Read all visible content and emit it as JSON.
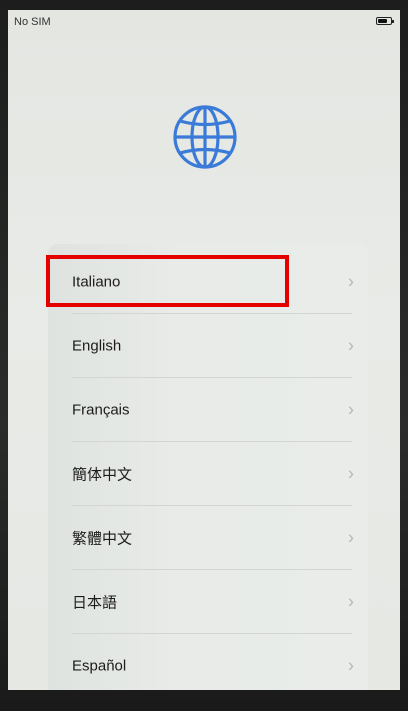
{
  "status_bar": {
    "carrier": "No SIM",
    "battery_icon": "battery-icon"
  },
  "header": {
    "icon": "globe-icon",
    "accent_color": "#3a7ad8"
  },
  "languages": [
    {
      "label": "Italiano",
      "chevron": "›",
      "highlighted": true
    },
    {
      "label": "English",
      "chevron": "›"
    },
    {
      "label": "Français",
      "chevron": "›"
    },
    {
      "label": "簡体中文",
      "chevron": "›"
    },
    {
      "label": "繁體中文",
      "chevron": "›"
    },
    {
      "label": "日本語",
      "chevron": "›"
    },
    {
      "label": "Español",
      "chevron": "›"
    }
  ],
  "highlight": {
    "target": "Italiano",
    "color": "#e50000"
  }
}
